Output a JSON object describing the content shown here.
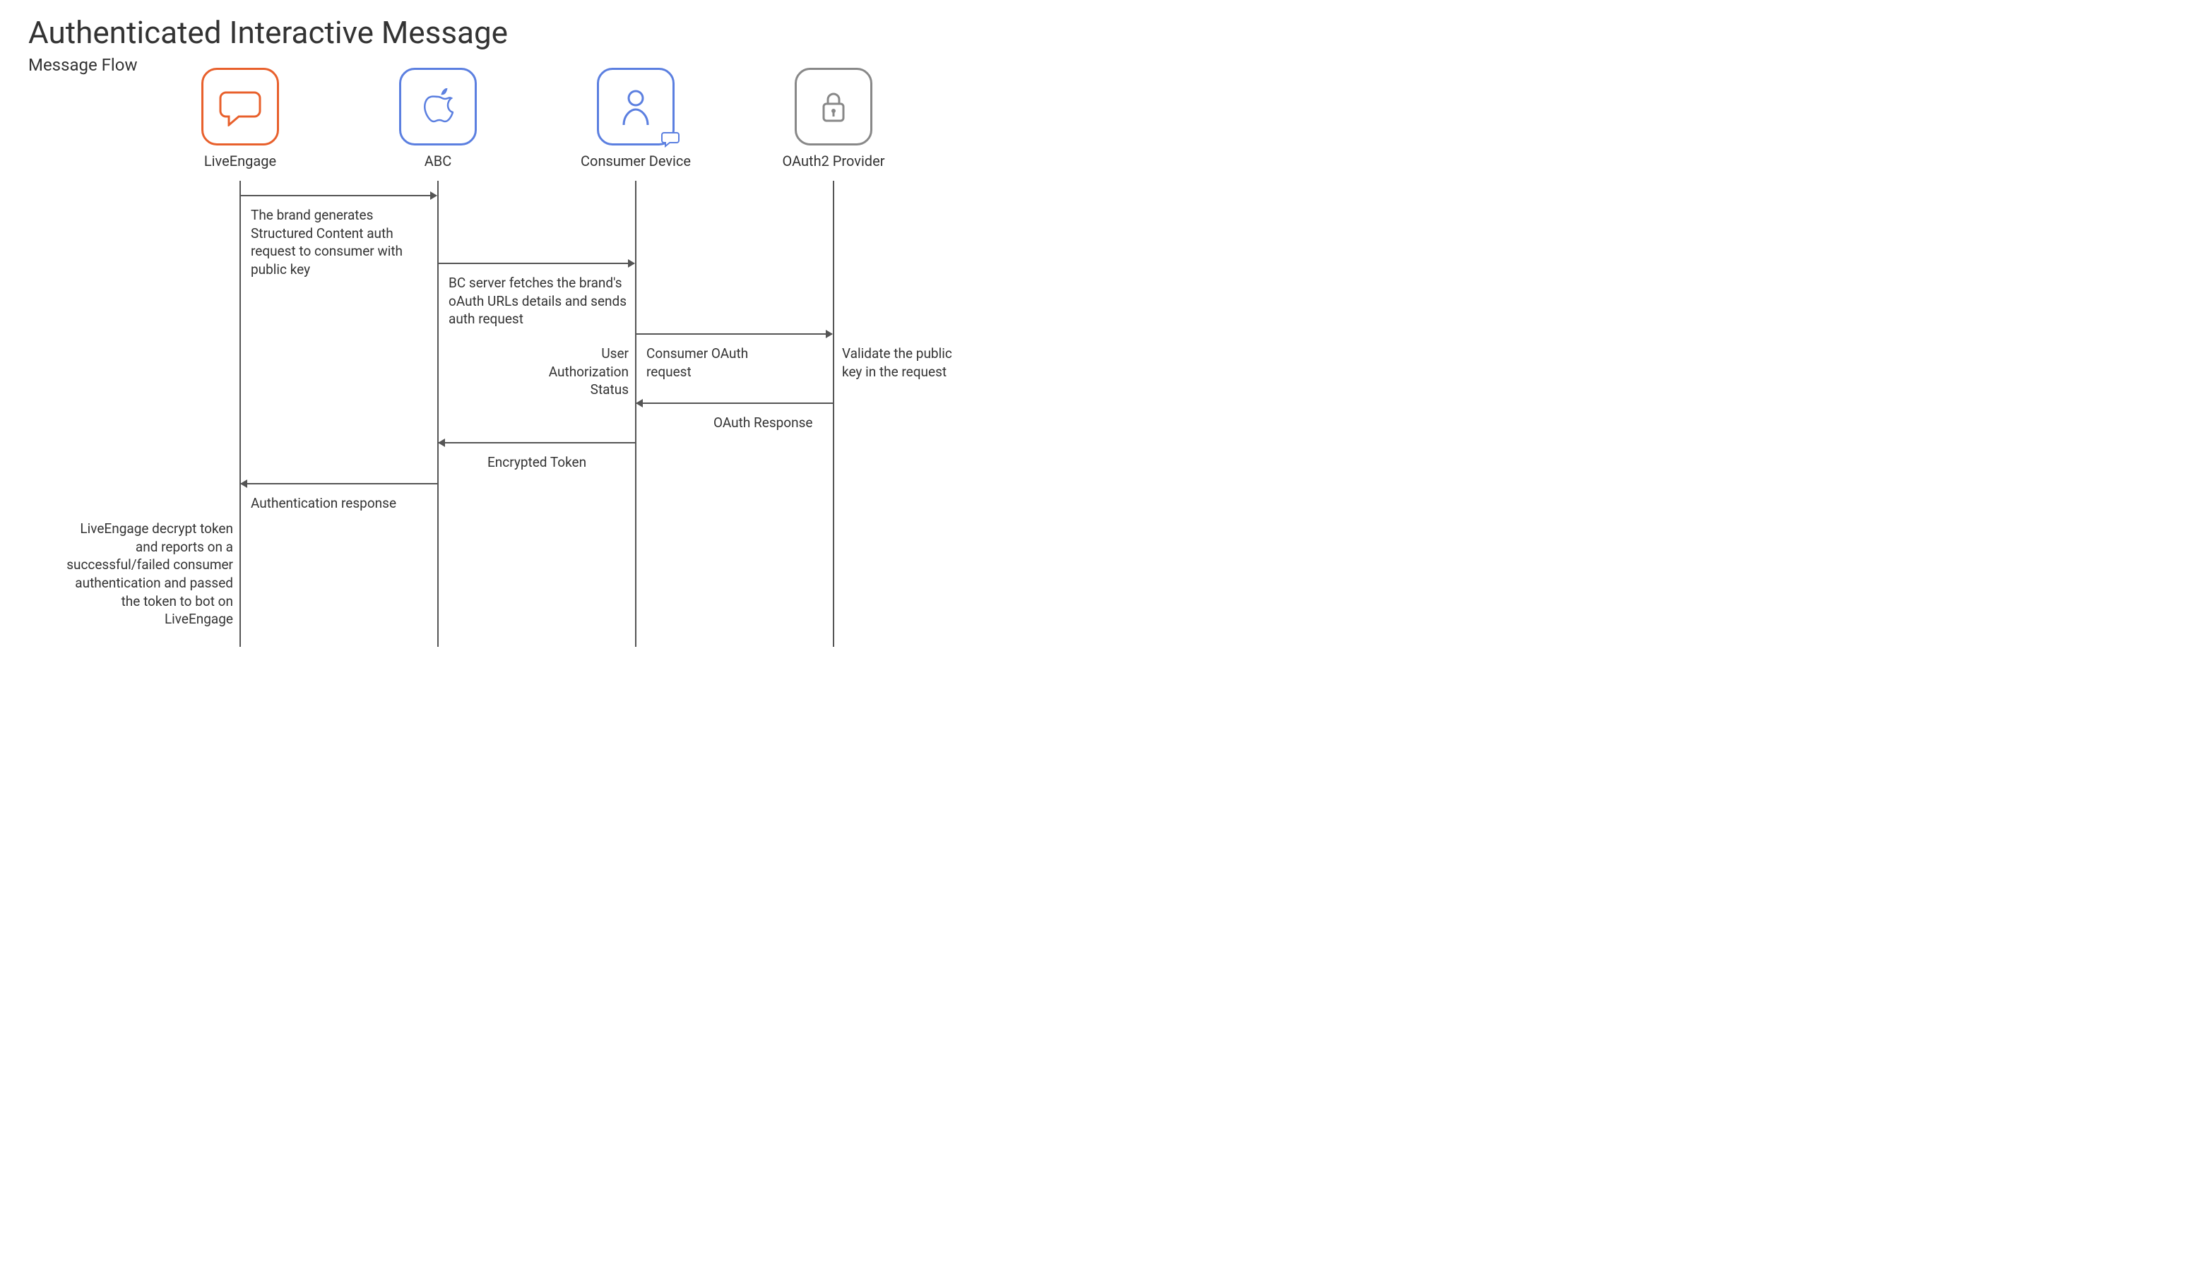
{
  "title": "Authenticated Interactive Message",
  "subtitle": "Message Flow",
  "participants": {
    "p1": {
      "label": "LiveEngage",
      "color": "#E8602C"
    },
    "p2": {
      "label": "ABC",
      "color": "#5B7FE0"
    },
    "p3": {
      "label": "Consumer Device",
      "color": "#5B7FE0"
    },
    "p4": {
      "label": "OAuth2 Provider",
      "color": "#888"
    }
  },
  "messages": {
    "m1": "The brand generates Structured Content auth request to consumer with public key",
    "m2": "BC server fetches the brand's oAuth URLs details and sends auth request",
    "m3": "Consumer OAuth request",
    "m3b": "User Authorization Status",
    "m4a": "Validate the public key in the request",
    "m4": "OAuth Response",
    "m5": "Encrypted Token",
    "m6": "Authentication response",
    "m7": "LiveEngage decrypt token and reports on a successful/failed consumer authentication and passed the token to bot on LiveEngage"
  }
}
